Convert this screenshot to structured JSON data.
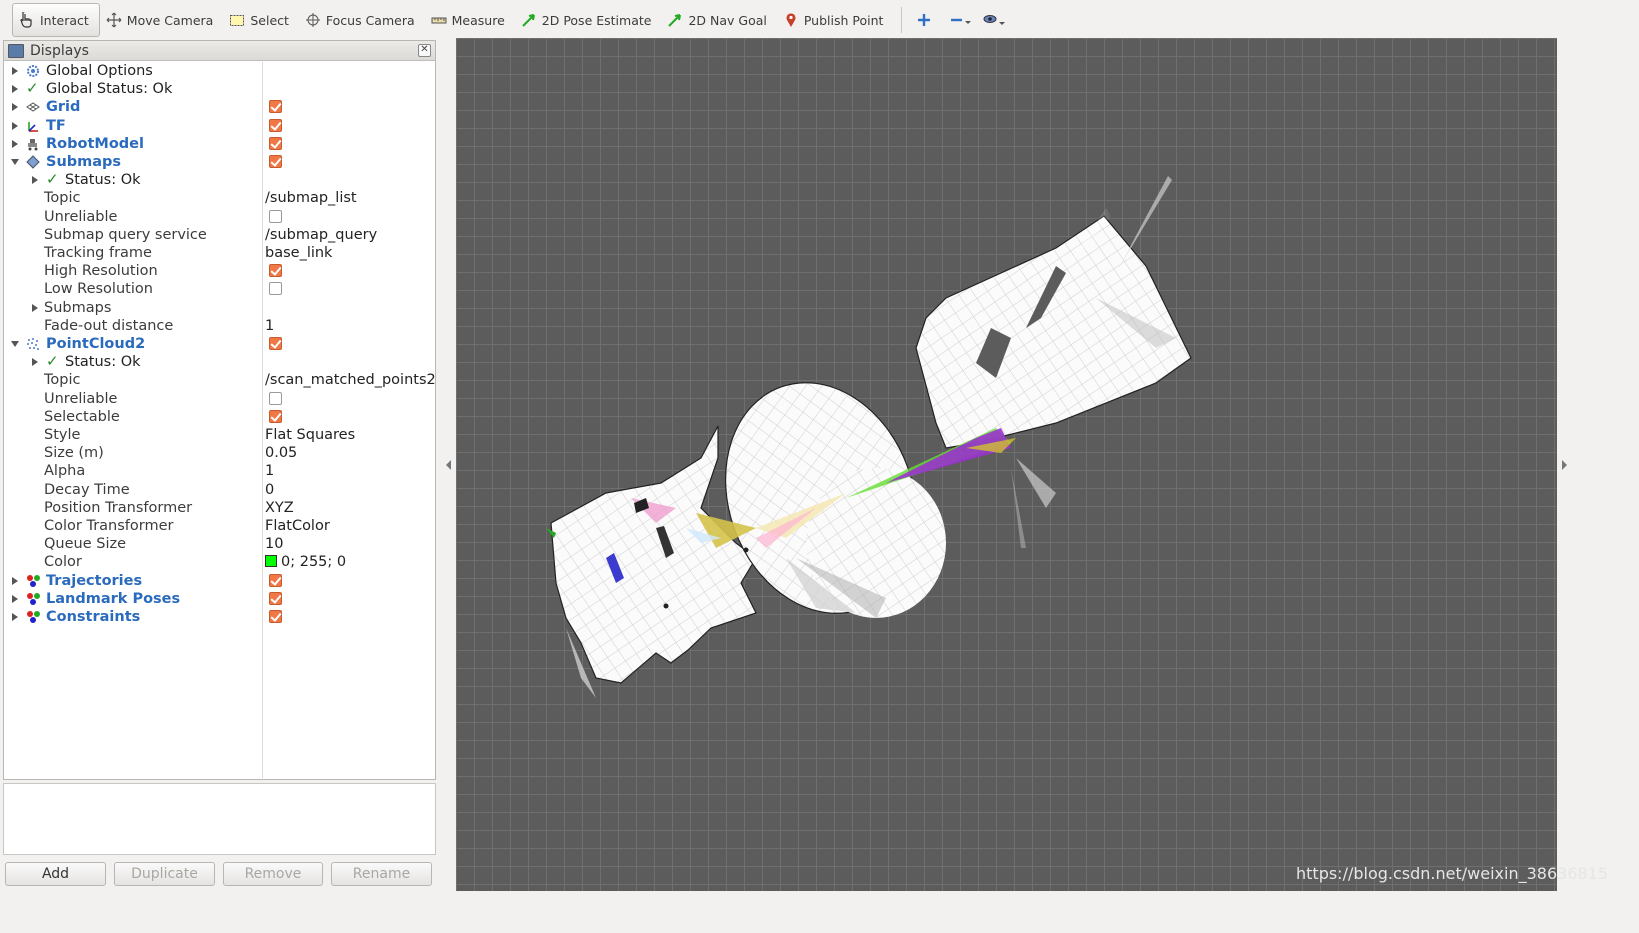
{
  "toolbar": {
    "items": [
      {
        "label": "Interact",
        "icon": "hand-pointer-icon",
        "active": true
      },
      {
        "label": "Move Camera",
        "icon": "move-arrows-icon"
      },
      {
        "label": "Select",
        "icon": "select-rect-icon"
      },
      {
        "label": "Focus Camera",
        "icon": "crosshair-icon"
      },
      {
        "label": "Measure",
        "icon": "ruler-icon"
      },
      {
        "label": "2D Pose Estimate",
        "icon": "green-arrow-icon"
      },
      {
        "label": "2D Nav Goal",
        "icon": "green-arrow-icon"
      },
      {
        "label": "Publish Point",
        "icon": "map-pin-icon"
      }
    ]
  },
  "displays_panel": {
    "title": "Displays",
    "rows": [
      {
        "label": "Global Options"
      },
      {
        "label": "Global Status: Ok"
      },
      {
        "label": "Grid",
        "checked": true
      },
      {
        "label": "TF",
        "checked": true
      },
      {
        "label": "RobotModel",
        "checked": true
      },
      {
        "label": "Submaps",
        "checked": true
      },
      {
        "label": "Status: Ok"
      },
      {
        "label": "Topic",
        "value": "/submap_list"
      },
      {
        "label": "Unreliable",
        "checked": false
      },
      {
        "label": "Submap query service",
        "value": "/submap_query"
      },
      {
        "label": "Tracking frame",
        "value": "base_link"
      },
      {
        "label": "High Resolution",
        "checked": true
      },
      {
        "label": "Low Resolution",
        "checked": false
      },
      {
        "label": "Submaps"
      },
      {
        "label": "Fade-out distance",
        "value": "1"
      },
      {
        "label": "PointCloud2",
        "checked": true
      },
      {
        "label": "Status: Ok"
      },
      {
        "label": "Topic",
        "value": "/scan_matched_points2"
      },
      {
        "label": "Unreliable",
        "checked": false
      },
      {
        "label": "Selectable",
        "checked": true
      },
      {
        "label": "Style",
        "value": "Flat Squares"
      },
      {
        "label": "Size (m)",
        "value": "0.05"
      },
      {
        "label": "Alpha",
        "value": "1"
      },
      {
        "label": "Decay Time",
        "value": "0"
      },
      {
        "label": "Position Transformer",
        "value": "XYZ"
      },
      {
        "label": "Color Transformer",
        "value": "FlatColor"
      },
      {
        "label": "Queue Size",
        "value": "10"
      },
      {
        "label": "Color",
        "value": "0; 255; 0",
        "swatch": "#00ff00"
      },
      {
        "label": "Trajectories",
        "checked": true
      },
      {
        "label": "Landmark Poses",
        "checked": true
      },
      {
        "label": "Constraints",
        "checked": true
      }
    ]
  },
  "buttons": {
    "add": "Add",
    "duplicate": "Duplicate",
    "remove": "Remove",
    "rename": "Rename"
  },
  "watermark": "https://blog.csdn.net/weixin_38636815"
}
